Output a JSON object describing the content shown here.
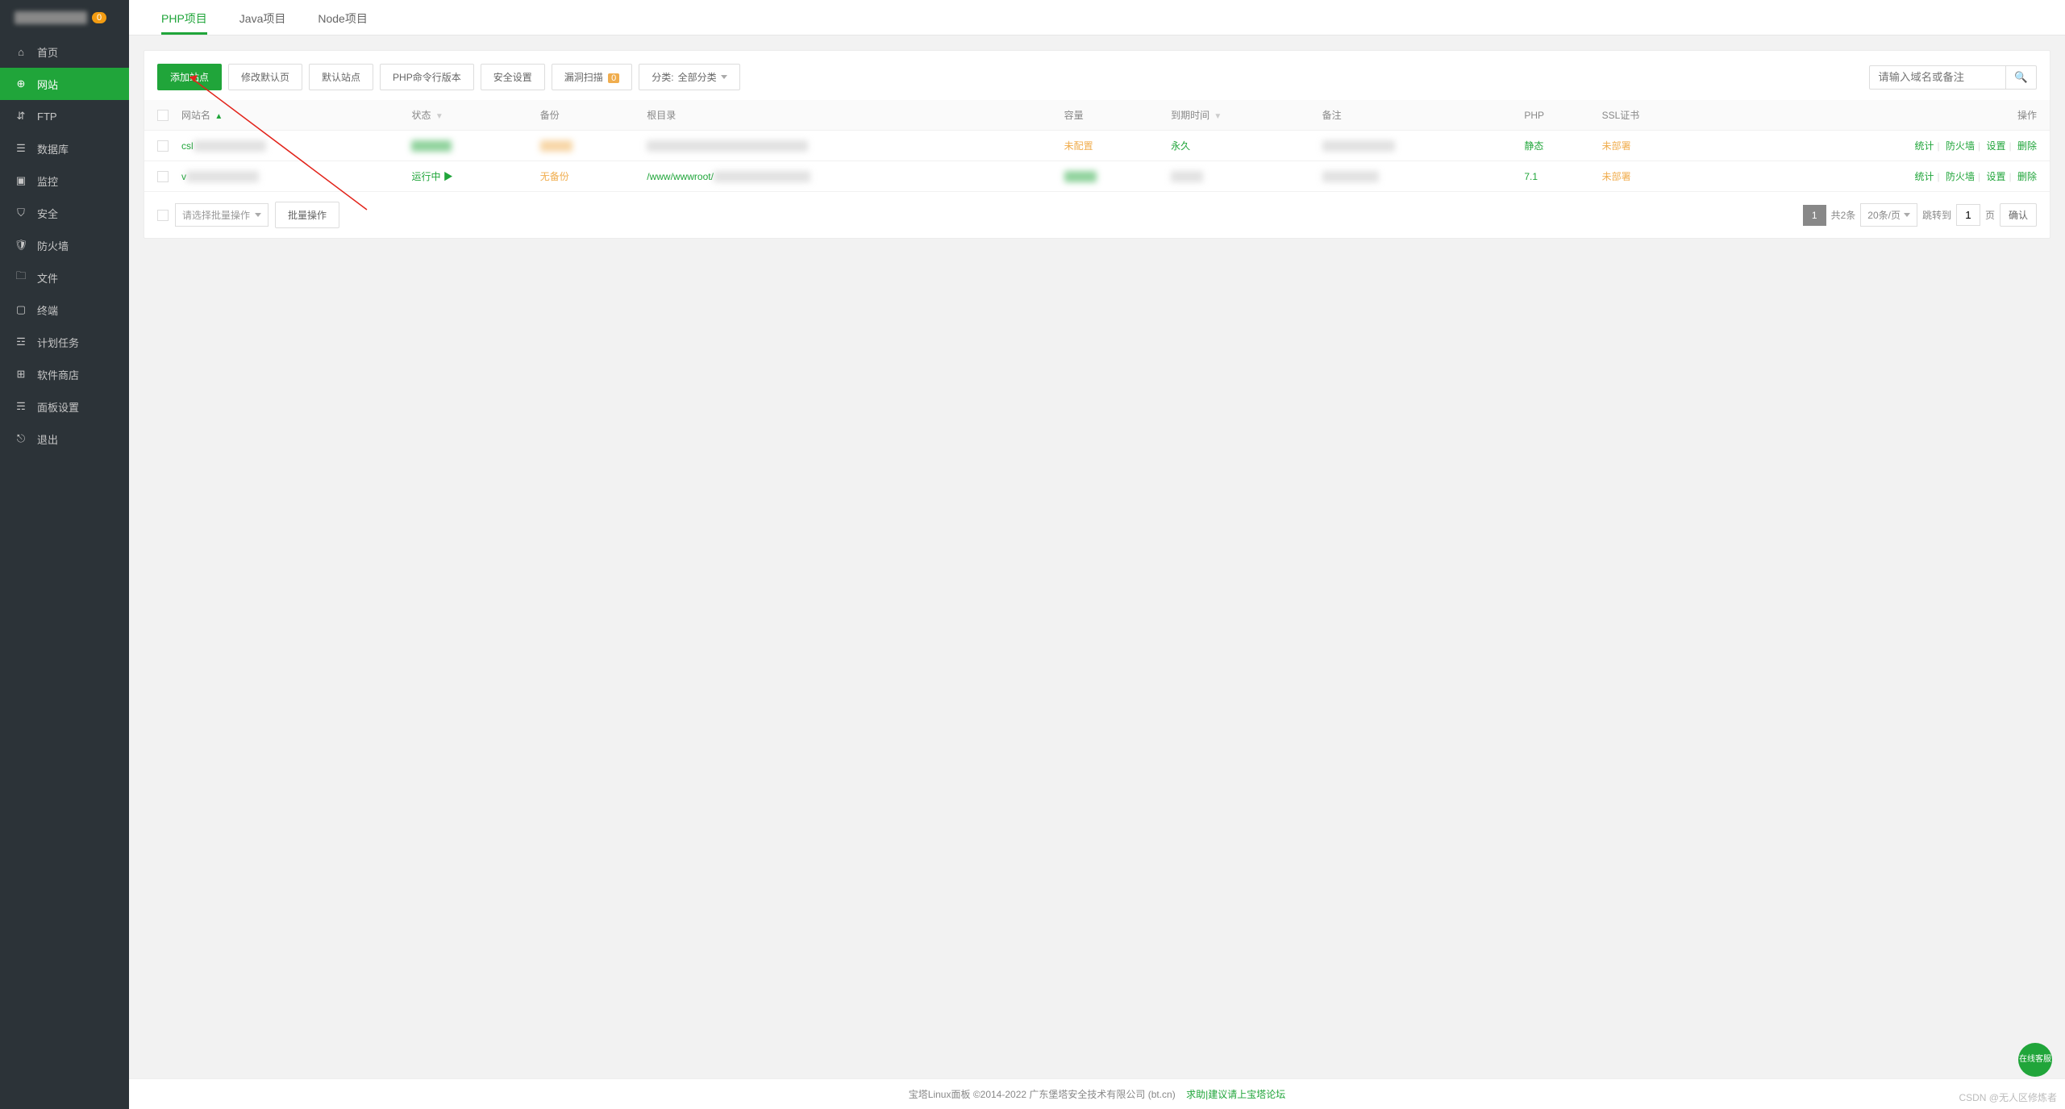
{
  "sidebar": {
    "logo_badge": "0",
    "items": [
      {
        "icon": "home-icon",
        "label": "首页"
      },
      {
        "icon": "globe-icon",
        "label": "网站",
        "active": true
      },
      {
        "icon": "ftp-icon",
        "label": "FTP"
      },
      {
        "icon": "database-icon",
        "label": "数据库"
      },
      {
        "icon": "monitor-icon",
        "label": "监控"
      },
      {
        "icon": "shield-icon",
        "label": "安全"
      },
      {
        "icon": "firewall-icon",
        "label": "防火墙"
      },
      {
        "icon": "folder-icon",
        "label": "文件"
      },
      {
        "icon": "terminal-icon",
        "label": "终端"
      },
      {
        "icon": "cron-icon",
        "label": "计划任务"
      },
      {
        "icon": "store-icon",
        "label": "软件商店"
      },
      {
        "icon": "settings-icon",
        "label": "面板设置"
      },
      {
        "icon": "exit-icon",
        "label": "退出"
      }
    ]
  },
  "tabs": [
    {
      "label": "PHP项目",
      "active": true
    },
    {
      "label": "Java项目"
    },
    {
      "label": "Node项目"
    }
  ],
  "toolbar": {
    "add_site": "添加站点",
    "edit_default": "修改默认页",
    "default_site": "默认站点",
    "php_cli": "PHP命令行版本",
    "safe_settings": "安全设置",
    "vuln_scan": "漏洞扫描",
    "vuln_count": "0",
    "category_label": "分类:",
    "category_value": "全部分类",
    "search_placeholder": "请输入域名或备注"
  },
  "table": {
    "headers": {
      "site": "网站名",
      "status": "状态",
      "backup": "备份",
      "root": "根目录",
      "capacity": "容量",
      "expire": "到期时间",
      "remark": "备注",
      "php": "PHP",
      "ssl": "SSL证书",
      "action": "操作"
    },
    "rows": [
      {
        "site_prefix": "csl",
        "status_blur": "██████",
        "backup_blur": "████",
        "root_blur": "████████████████████████",
        "capacity": "未配置",
        "expire": "永久",
        "remark_blur": "████████████",
        "php": "静态",
        "ssl": "未部署"
      },
      {
        "site_prefix": "v",
        "status": "运行中",
        "backup": "无备份",
        "root_prefix": "/www/wwwroot/",
        "capacity_blur": "████",
        "expire_blur": "████",
        "remark_blur": "██████████",
        "php": "7.1",
        "ssl": "未部署"
      }
    ],
    "actions": {
      "stats": "统计",
      "firewall": "防火墙",
      "settings": "设置",
      "delete": "删除"
    }
  },
  "footer": {
    "batch_placeholder": "请选择批量操作",
    "batch_btn": "批量操作",
    "total_label": "共2条",
    "per_page": "20条/页",
    "jump_label": "跳转到",
    "page_value": "1",
    "page_suffix": "页",
    "confirm": "确认",
    "current_page": "1"
  },
  "bottom": {
    "copyright": "宝塔Linux面板 ©2014-2022 广东堡塔安全技术有限公司 (bt.cn)",
    "help_link": "求助|建议请上宝塔论坛"
  },
  "float_help": "在线客服",
  "watermark": "CSDN @无人区修炼者"
}
